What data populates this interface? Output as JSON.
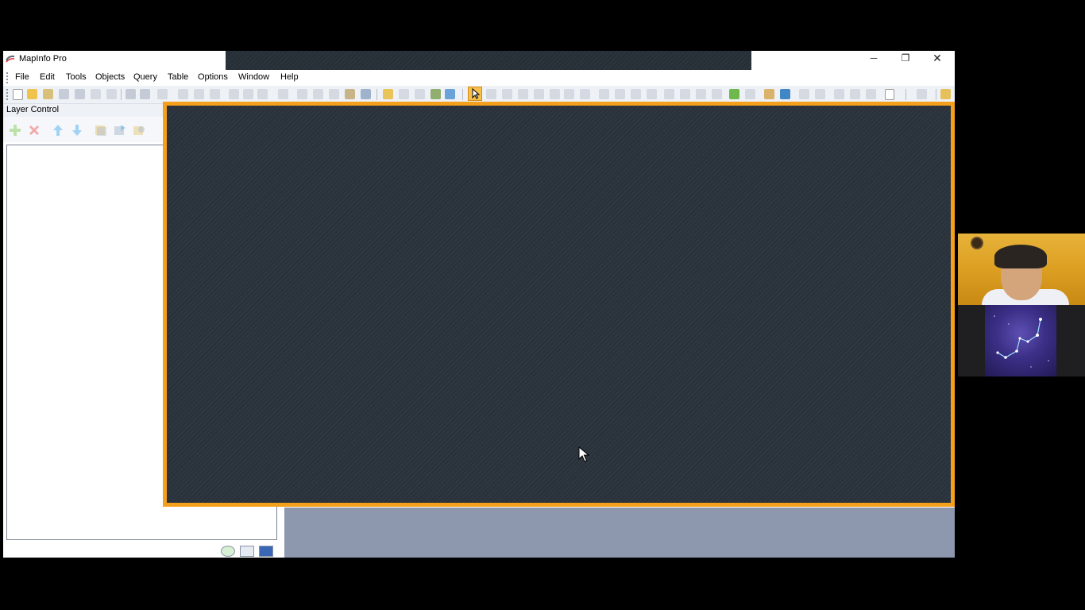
{
  "window": {
    "title": "MapInfo Pro",
    "controls": {
      "minimize": "─",
      "maximize": "❐",
      "close": "✕"
    }
  },
  "menubar": {
    "items": [
      "File",
      "Edit",
      "Tools",
      "Objects",
      "Query",
      "Table",
      "Options",
      "Window",
      "Help"
    ]
  },
  "layer_control": {
    "title": "Layer Control",
    "tools": [
      "add-layer",
      "remove-layer",
      "move-up",
      "move-down",
      "layer-properties",
      "reorder",
      "refresh"
    ]
  },
  "colors": {
    "map_frame": "#f5a01d",
    "map_background": "#2c343d",
    "mdi_background": "#8d97ad",
    "active_tool": "#f7c04a"
  },
  "toolbar": {
    "active_tool": "select-tool"
  }
}
